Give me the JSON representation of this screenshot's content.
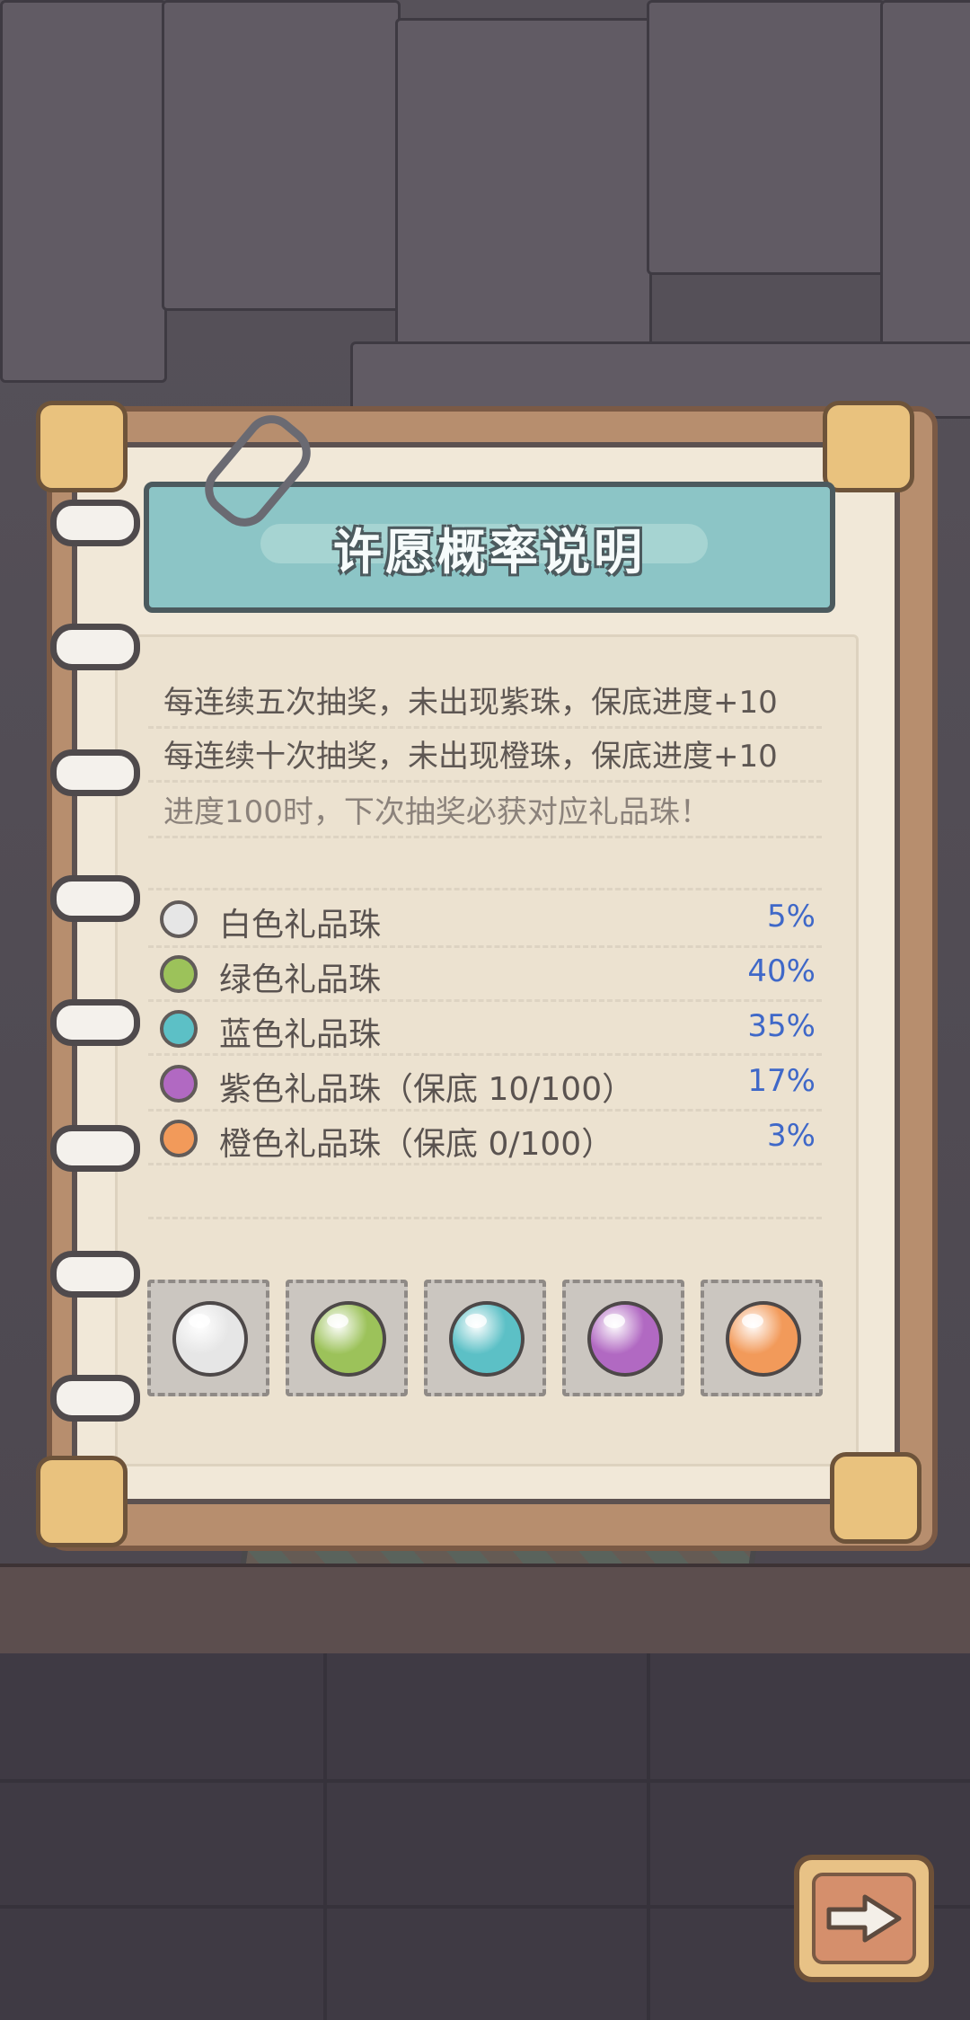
{
  "dialog": {
    "title": "许愿概率说明",
    "rules": [
      "每连续五次抽奖，未出现紫珠，保底进度+10",
      "每连续十次抽奖，未出现橙珠，保底进度+10",
      "进度100时，下次抽奖必获对应礼品珠！"
    ],
    "probabilities": [
      {
        "label": "白色礼品珠",
        "value": "5%",
        "color": "#e6e6e6"
      },
      {
        "label": "绿色礼品珠",
        "value": "40%",
        "color": "#9cc25a"
      },
      {
        "label": "蓝色礼品珠",
        "value": "35%",
        "color": "#5cc0c6"
      },
      {
        "label": "紫色礼品珠（保底  10/100）",
        "value": "17%",
        "color": "#b169c2"
      },
      {
        "label": "橙色礼品珠（保底  0/100）",
        "value": "3%",
        "color": "#f29a5a"
      }
    ],
    "stamp_icons": [
      "white-orb-icon",
      "green-orb-icon",
      "blue-orb-icon",
      "purple-orb-icon",
      "orange-orb-icon"
    ]
  },
  "colors": {
    "value_text": "#3f68c8",
    "header_bg": "#8cc5c6"
  },
  "next_button": {
    "icon": "arrow-right-icon"
  }
}
